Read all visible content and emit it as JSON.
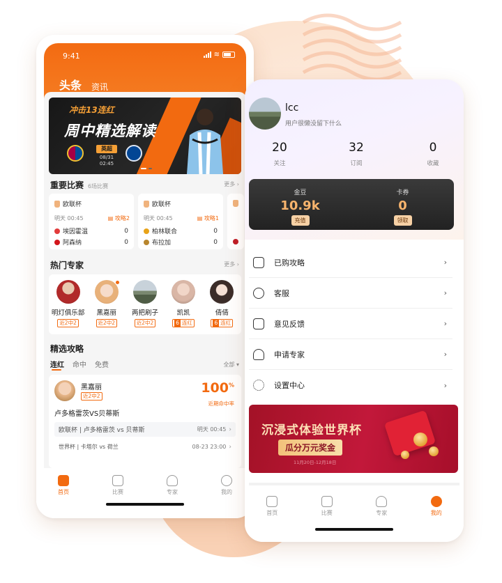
{
  "left": {
    "status_time": "9:41",
    "tabs": {
      "active": "头条",
      "other": "资讯"
    },
    "banner": {
      "subtitle": "冲击13连红",
      "title": "周中精选解读",
      "league": "英超",
      "date": "08/31",
      "time": "02:45"
    },
    "important": {
      "title": "重要比赛",
      "count": "6场比赛",
      "more": "更多",
      "cards": [
        {
          "league": "欧联杯",
          "time": "明天 00:45",
          "tips": "攻略2",
          "home": "埃因霍温",
          "home_score": "0",
          "away": "阿森纳",
          "away_score": "0"
        },
        {
          "league": "欧联杯",
          "time": "明天 00:45",
          "tips": "攻略1",
          "home": "柏林联合",
          "home_score": "0",
          "away": "布拉加",
          "away_score": "0"
        }
      ]
    },
    "experts": {
      "title": "热门专家",
      "more": "更多",
      "items": [
        {
          "name": "明灯俱乐部",
          "tag": "近2中2",
          "badge": ""
        },
        {
          "name": "黑嘉丽",
          "tag": "近2中2",
          "badge": ""
        },
        {
          "name": "两把刷子",
          "tag": "近2中2",
          "badge": ""
        },
        {
          "name": "凯凯",
          "tag": "连红",
          "badge": "6"
        },
        {
          "name": "倩倩",
          "tag": "连红",
          "badge": "6"
        }
      ]
    },
    "strategy": {
      "title": "精选攻略",
      "tabs": [
        "连红",
        "命中",
        "免费"
      ],
      "filter": "全部",
      "card": {
        "author": "黑嘉丽",
        "tag": "近2中2",
        "rate": "100",
        "rate_unit": "%",
        "rate_label": "近期命中率",
        "title": "卢多格雷茨VS贝蒂斯",
        "matches": [
          {
            "text": "欧联杯 | 卢多格雷茨 vs 贝蒂斯",
            "time": "明天 00:45"
          },
          {
            "text": "世界杯 | 卡塔尔 vs 荷兰",
            "time": "08-23 23:00"
          }
        ]
      }
    },
    "tabbar": [
      "首页",
      "比赛",
      "专家",
      "我的"
    ]
  },
  "right": {
    "profile": {
      "name": "lcc",
      "bio": "用户很懒没留下什么"
    },
    "stats": [
      {
        "value": "20",
        "label": "关注"
      },
      {
        "value": "32",
        "label": "订阅"
      },
      {
        "value": "0",
        "label": "收藏"
      }
    ],
    "wallet": [
      {
        "label": "金豆",
        "value": "10.9k",
        "button": "充值"
      },
      {
        "label": "卡券",
        "value": "0",
        "button": "领取"
      }
    ],
    "menu": [
      "已购攻略",
      "客服",
      "意见反馈",
      "申请专家",
      "设置中心"
    ],
    "promo": {
      "title": "沉浸式体验世界杯",
      "pill": "瓜分万元奖金",
      "date": "11月20日-12月18日"
    },
    "tabbar": [
      "首页",
      "比赛",
      "专家",
      "我的"
    ]
  },
  "colors": {
    "accent": "#f26a10",
    "wallet_bg": "#2a2a2a",
    "promo_bg": "#b3152f"
  }
}
